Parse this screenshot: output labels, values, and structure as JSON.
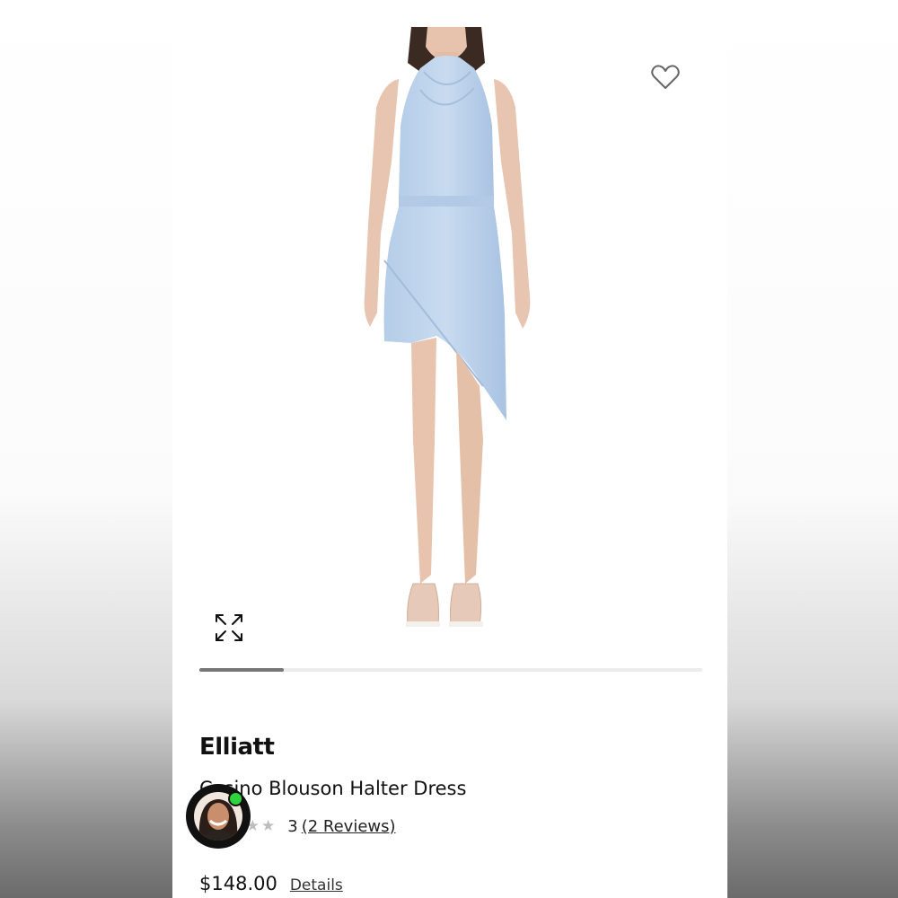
{
  "product": {
    "brand": "Elliatt",
    "name": "Casino Blouson Halter Dress",
    "price": "$148.00",
    "details_label": "Details",
    "rating": {
      "value": "3",
      "reviews_label": "(2 Reviews)",
      "stars_filled": 3,
      "stars_total": 5
    },
    "image_gallery_progress": 0.167
  },
  "icons": {
    "favorite": "heart-outline-icon",
    "expand": "expand-arrows-icon"
  },
  "colors": {
    "dress": "#bcd3ec",
    "progress_fill": "#777777",
    "progress_track": "#ececec",
    "online": "#2fd33e"
  }
}
